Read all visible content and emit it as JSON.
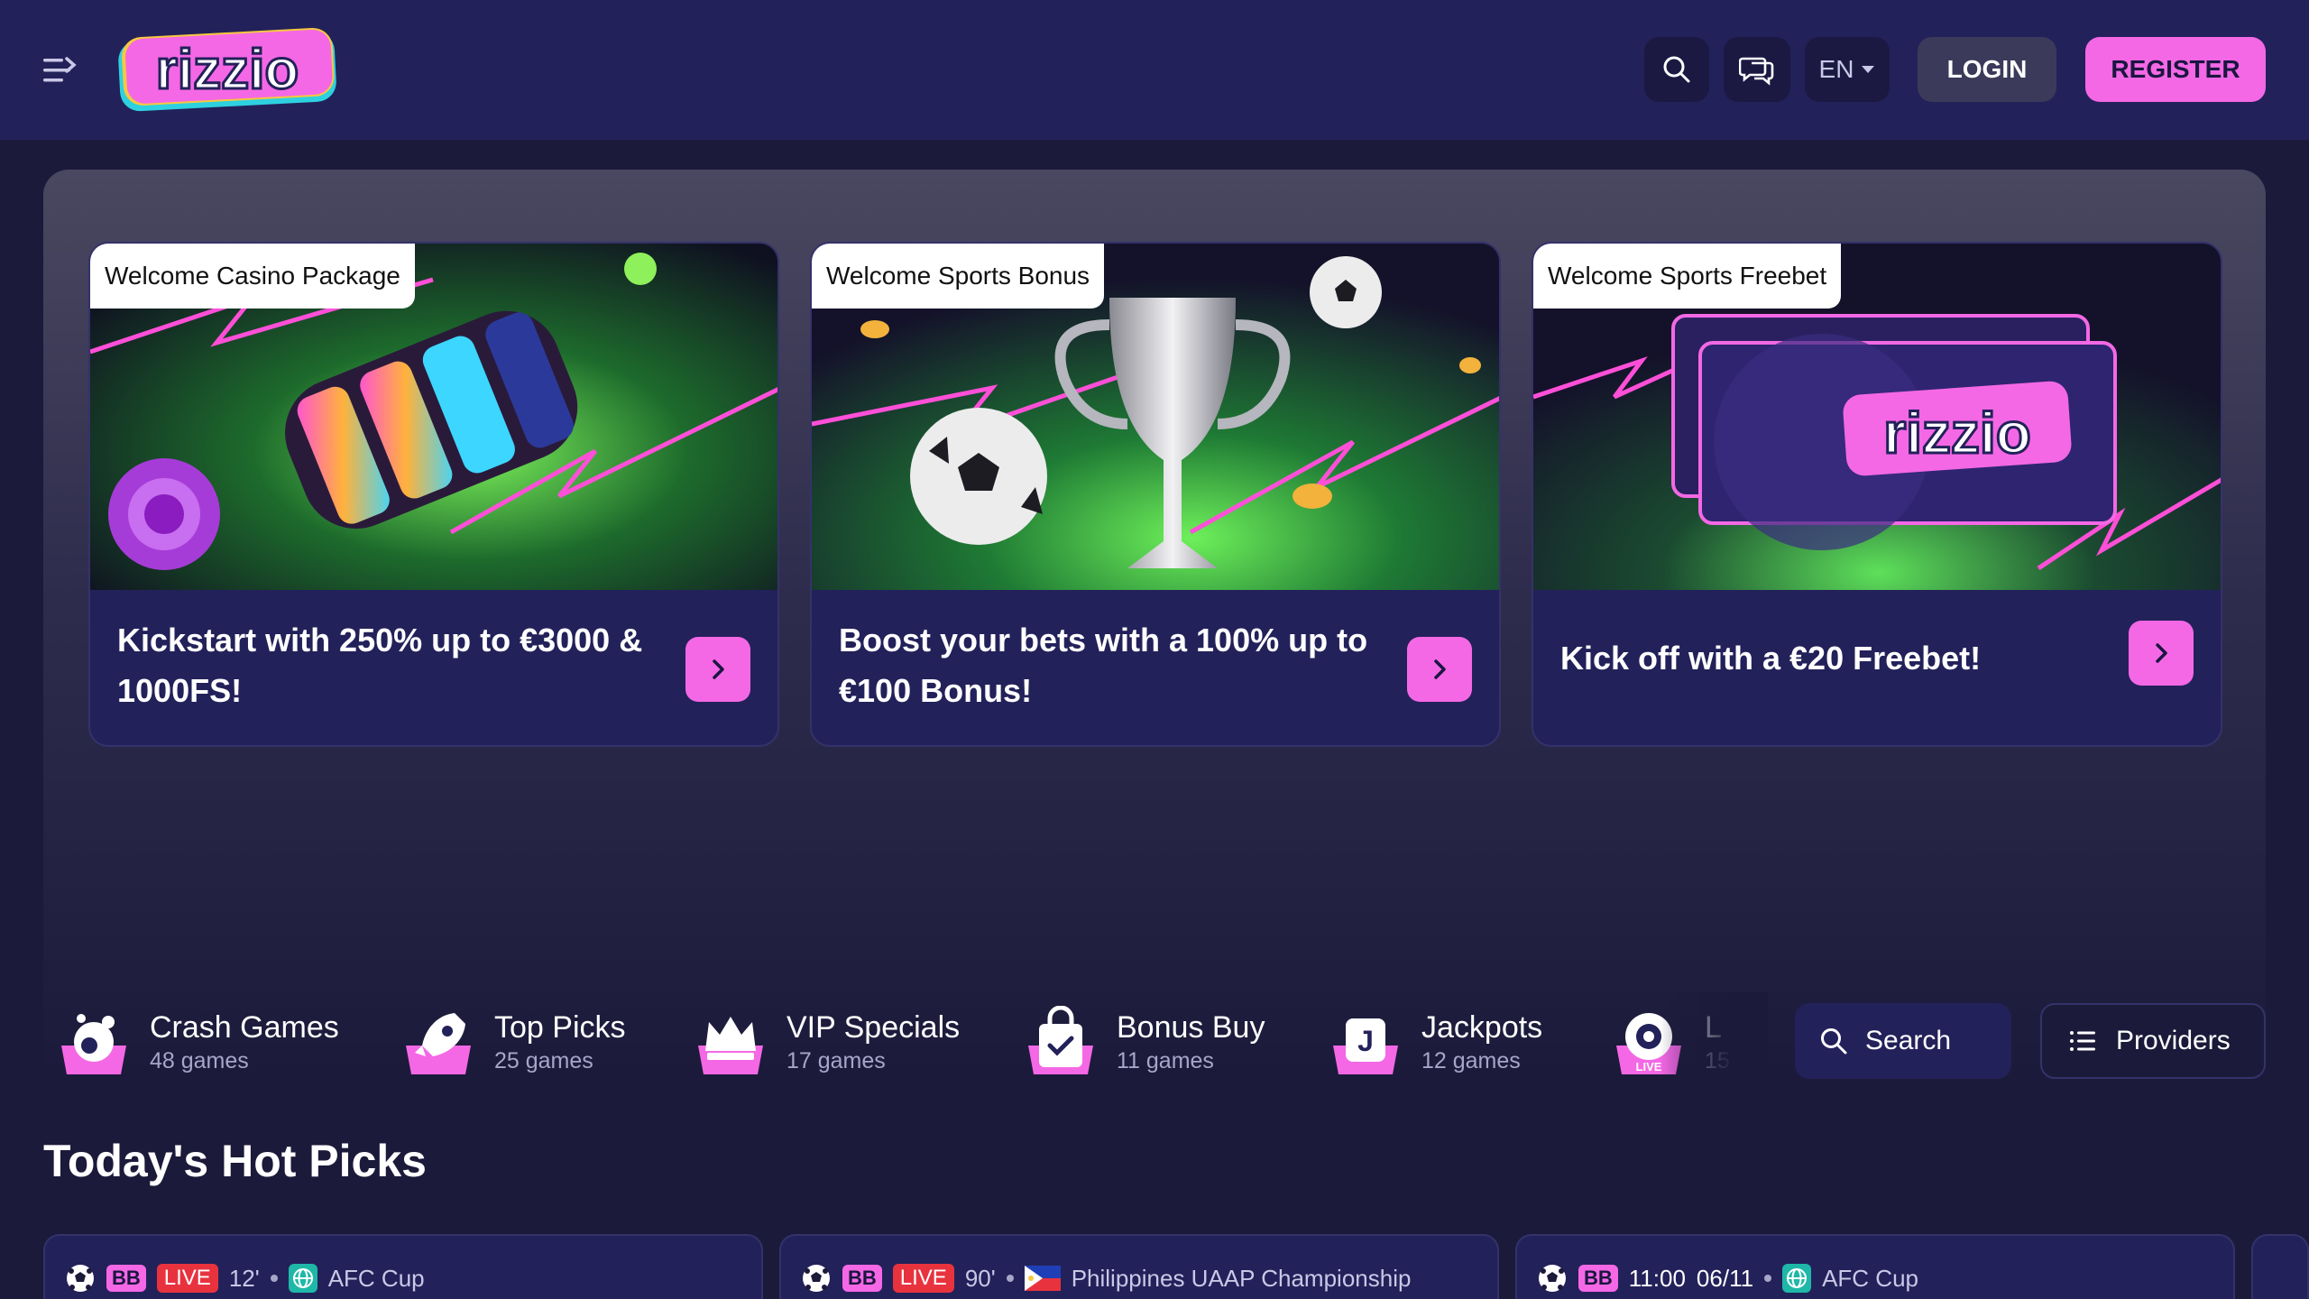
{
  "header": {
    "logo_text": "rizzio",
    "lang_label": "EN",
    "login_label": "LOGIN",
    "register_label": "REGISTER"
  },
  "promos": [
    {
      "tag": "Welcome Casino Package",
      "text": "Kickstart with 250% up to €3000 & 1000FS!"
    },
    {
      "tag": "Welcome Sports Bonus",
      "text": "Boost your bets with a 100% up to €100 Bonus!"
    },
    {
      "tag": "Welcome Sports Freebet",
      "text": "Kick off with a €20 Freebet!",
      "banner_logo": "rizzio"
    }
  ],
  "categories": [
    {
      "name": "Crash Games",
      "count": "48 games",
      "icon": "crash-games-icon"
    },
    {
      "name": "Top Picks",
      "count": "25 games",
      "icon": "rocket-icon"
    },
    {
      "name": "VIP Specials",
      "count": "17 games",
      "icon": "crown-icon"
    },
    {
      "name": "Bonus Buy",
      "count": "11 games",
      "icon": "shopping-bag-icon"
    },
    {
      "name": "Jackpots",
      "count": "12 games",
      "icon": "jackpot-icon"
    },
    {
      "name": "L",
      "count": "15",
      "icon": "live-roulette-icon",
      "icon_text": "LIVE"
    }
  ],
  "tools": {
    "search_label": "Search",
    "providers_label": "Providers"
  },
  "section_title": "Today's Hot Picks",
  "matches": [
    {
      "badge": "BB",
      "live": "LIVE",
      "minute": "12'",
      "league": "AFC Cup"
    },
    {
      "badge": "BB",
      "live": "LIVE",
      "minute": "90'",
      "league": "Philippines UAAP Championship"
    },
    {
      "badge": "BB",
      "time": "11:00",
      "date": "06/11",
      "league": "AFC Cup"
    }
  ],
  "colors": {
    "accent": "#f468e5",
    "header_bg": "#23215a",
    "page_bg": "#1c1a3a",
    "live": "#e8333f"
  }
}
